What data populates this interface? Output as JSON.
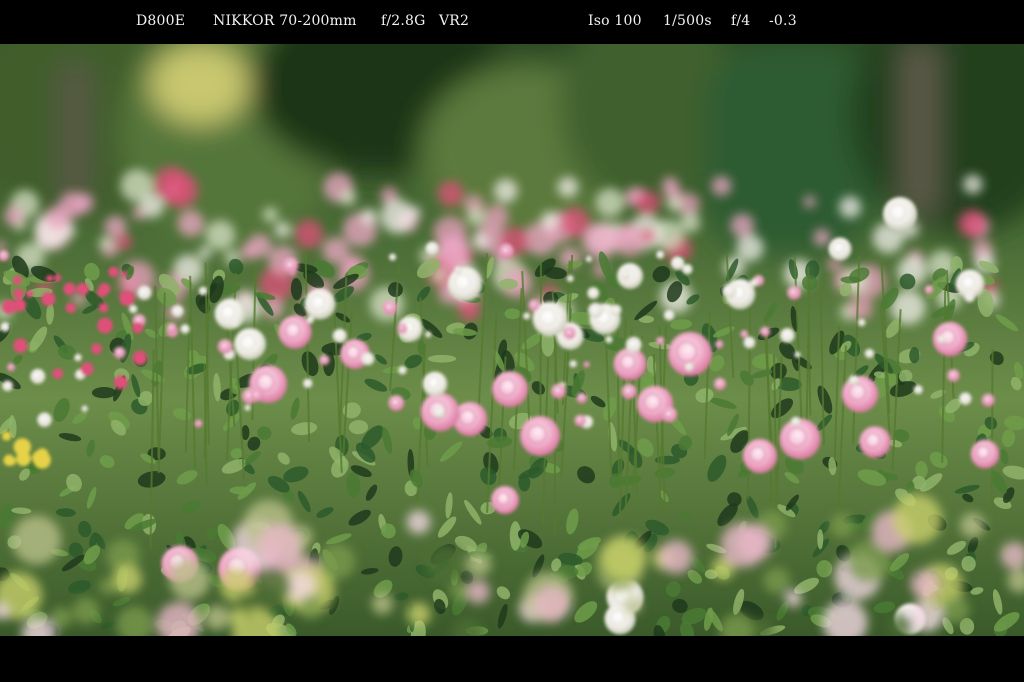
{
  "exif": {
    "camera": "D800E",
    "lens": "NIKKOR   70-200mm",
    "aperture_max": "f/2.8G",
    "vr": "VR2",
    "iso": "Iso 100",
    "shutter": "1/500s",
    "aperture": "f/4",
    "exposure_comp": "-0.3"
  },
  "photo": {
    "subject": "rose-garden",
    "palette": {
      "foliage_dark": "#1f3a1c",
      "foliage_mid": "#4a7a34",
      "foliage_light": "#8fb36a",
      "rose_pink": "#f0a8c8",
      "rose_white": "#f4f1ec",
      "rose_magenta": "#e0507a",
      "accent_yellow": "#e6d24a"
    }
  }
}
